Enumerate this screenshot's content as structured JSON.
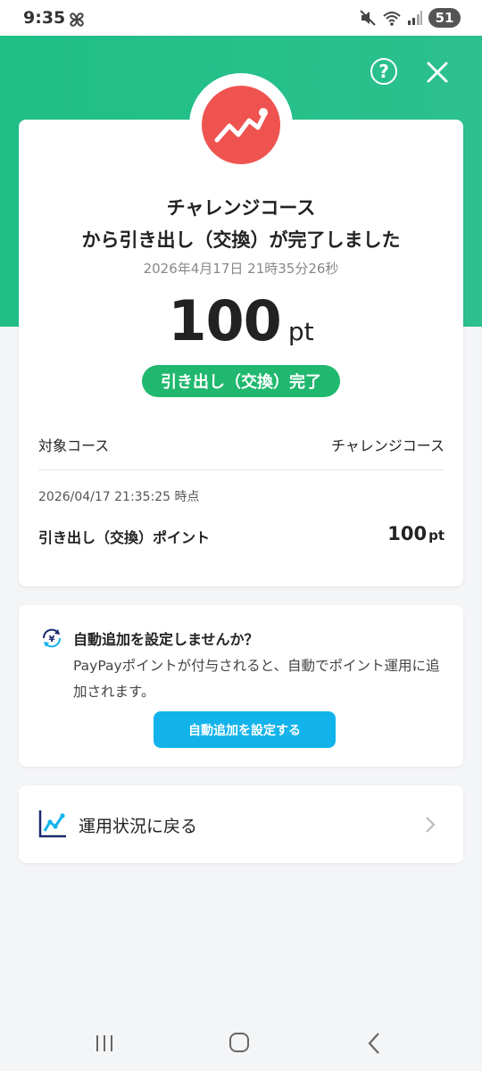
{
  "status_bar": {
    "time": "9:35",
    "battery": "51"
  },
  "header": {
    "help_label": "?"
  },
  "result": {
    "title_line1": "チャレンジコース",
    "title_line2": "から引き出し（交換）が完了しました",
    "datetime": "2026年4月17日 21時35分26秒",
    "amount": "100",
    "amount_unit": "pt",
    "status_badge": "引き出し（交換）完了"
  },
  "details": {
    "course_label": "対象コース",
    "course_value": "チャレンジコース",
    "timestamp": "2026/04/17 21:35:25 時点",
    "points_label": "引き出し（交換）ポイント",
    "points_value": "100",
    "points_unit": "pt"
  },
  "auto_add": {
    "title": "自動追加を設定しませんか？",
    "description": "PayPayポイントが付与されると、自動でポイント運用に追加されます。",
    "button_label": "自動追加を設定する"
  },
  "back_link": {
    "label": "運用状況に戻る"
  },
  "colors": {
    "header_green": "#1fbf86",
    "badge_red": "#ef5350",
    "status_green": "#20b86e",
    "button_blue": "#12b3ea"
  },
  "icons": {
    "status": [
      "pinwheel-icon",
      "mute-icon",
      "wifi-icon",
      "signal-icon",
      "battery-icon"
    ],
    "header": [
      "help-icon",
      "close-icon"
    ],
    "badge": "trend-up-icon",
    "auto_add": "auto-add-icon",
    "back_link": [
      "chart-icon",
      "chevron-right-icon"
    ],
    "navbar": [
      "recent-apps-icon",
      "home-icon",
      "back-icon"
    ]
  }
}
